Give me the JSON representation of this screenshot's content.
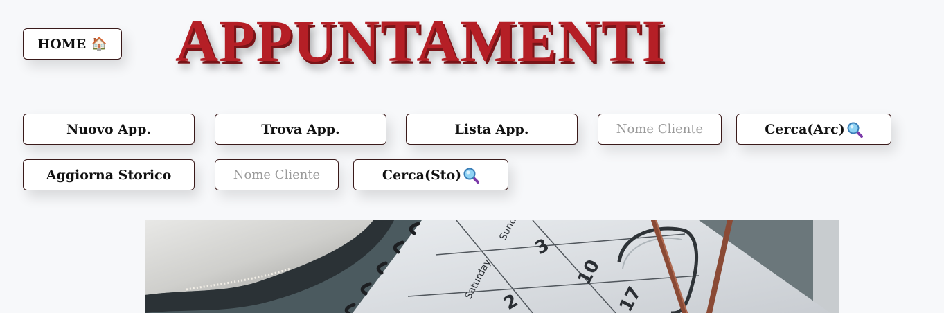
{
  "header": {
    "home_label": "HOME",
    "home_icon": "house-icon",
    "title": "APPUNTAMENTI"
  },
  "toolbar": {
    "nuovo_label": "Nuovo App.",
    "trova_label": "Trova App.",
    "lista_label": "Lista App.",
    "cliente_arc_placeholder": "Nome Cliente",
    "cerca_arc_label": "Cerca(Arc)",
    "aggiorna_label": "Aggiorna Storico",
    "cliente_sto_placeholder": "Nome Cliente",
    "cerca_sto_label": "Cerca(Sto)",
    "search_icon": "magnifier-icon"
  },
  "hero": {
    "calendar": {
      "day_names": [
        "Saturday",
        "Sunday"
      ],
      "numbers": [
        "3",
        "10",
        "2",
        "17"
      ]
    }
  },
  "colors": {
    "title_red": "#b51f26",
    "background": "#f7f8fa",
    "button_border": "#3a1a1a"
  }
}
